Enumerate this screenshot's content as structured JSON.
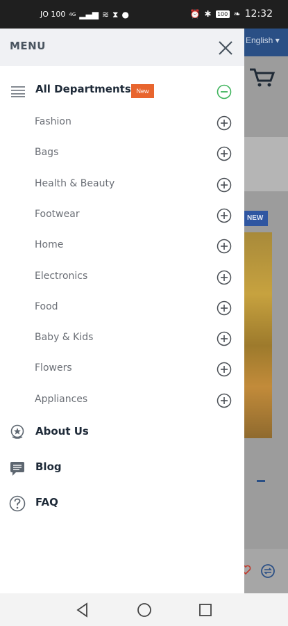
{
  "status_bar": {
    "carrier": "JO 100",
    "network": "4G",
    "battery": "100",
    "time": "12:32",
    "icons": [
      "signal-icon",
      "wifi-icon",
      "hourglass-icon",
      "chat-icon",
      "alarm-icon",
      "bluetooth-icon",
      "battery-icon",
      "leaf-icon"
    ]
  },
  "background_app": {
    "language": "English",
    "new_chip": "NEW"
  },
  "drawer": {
    "title": "MENU",
    "departments": {
      "label": "All Departments",
      "badge": "New",
      "categories": [
        {
          "label": "Fashion"
        },
        {
          "label": "Bags"
        },
        {
          "label": "Health & Beauty"
        },
        {
          "label": "Footwear"
        },
        {
          "label": "Home"
        },
        {
          "label": "Electronics"
        },
        {
          "label": "Food"
        },
        {
          "label": "Baby & Kids"
        },
        {
          "label": "Flowers"
        },
        {
          "label": "Appliances"
        }
      ]
    },
    "links": [
      {
        "label": "About Us",
        "icon": "badge-star-icon"
      },
      {
        "label": "Blog",
        "icon": "blog-icon"
      },
      {
        "label": "FAQ",
        "icon": "question-icon"
      }
    ]
  },
  "colors": {
    "accent_green": "#3cb35a",
    "badge_orange": "#e8652e",
    "header_bg": "#f0f1f4",
    "brand_blue": "#2a4f85"
  }
}
